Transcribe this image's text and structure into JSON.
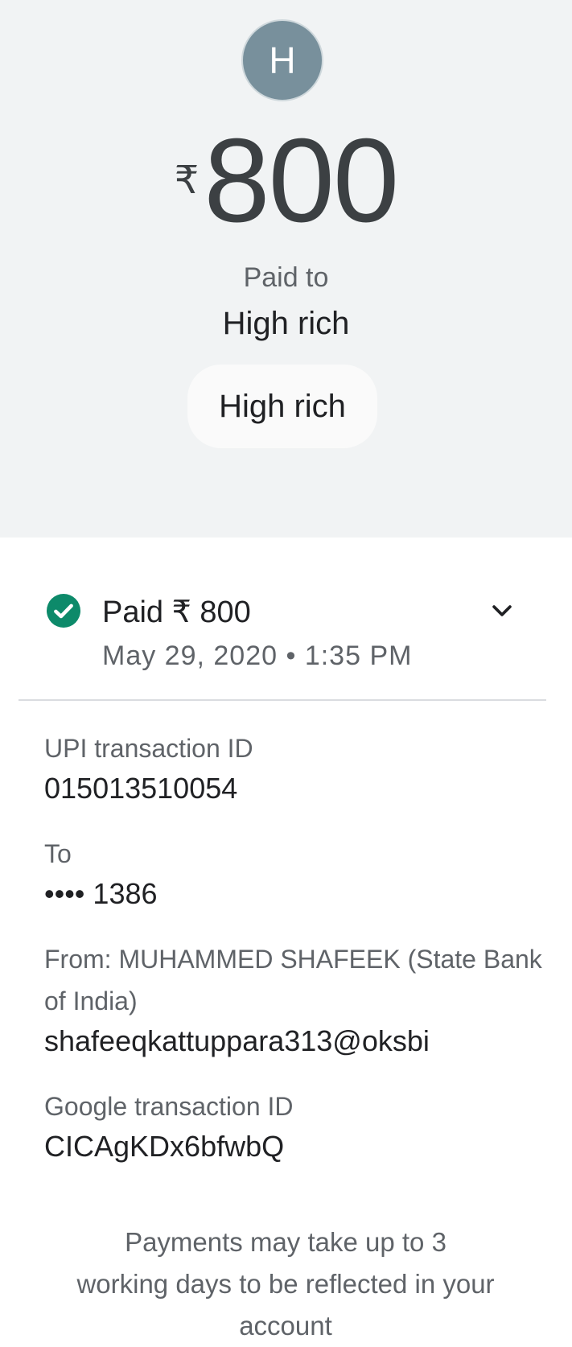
{
  "header": {
    "avatar_initial": "H",
    "currency_symbol": "₹",
    "amount": "800",
    "paid_to_label": "Paid to",
    "payee_name": "High rich",
    "payee_chip": "High rich"
  },
  "status": {
    "title": "Paid ₹ 800",
    "datetime": "May 29, 2020 • 1:35 PM",
    "icon": "check-circle-icon",
    "expand_icon": "chevron-down-icon",
    "color": "#0d8a6a"
  },
  "details": {
    "upi_label": "UPI transaction ID",
    "upi_value": "015013510054",
    "to_label": "To",
    "to_value": "•••• 1386",
    "from_label": "From: MUHAMMED  SHAFEEK (State Bank of India)",
    "from_value": "shafeeqkattuppara313@oksbi",
    "google_label": "Google transaction ID",
    "google_value": "CICAgKDx6bfwbQ"
  },
  "notice": "Payments may take up to 3 working days to be reflected in your account"
}
